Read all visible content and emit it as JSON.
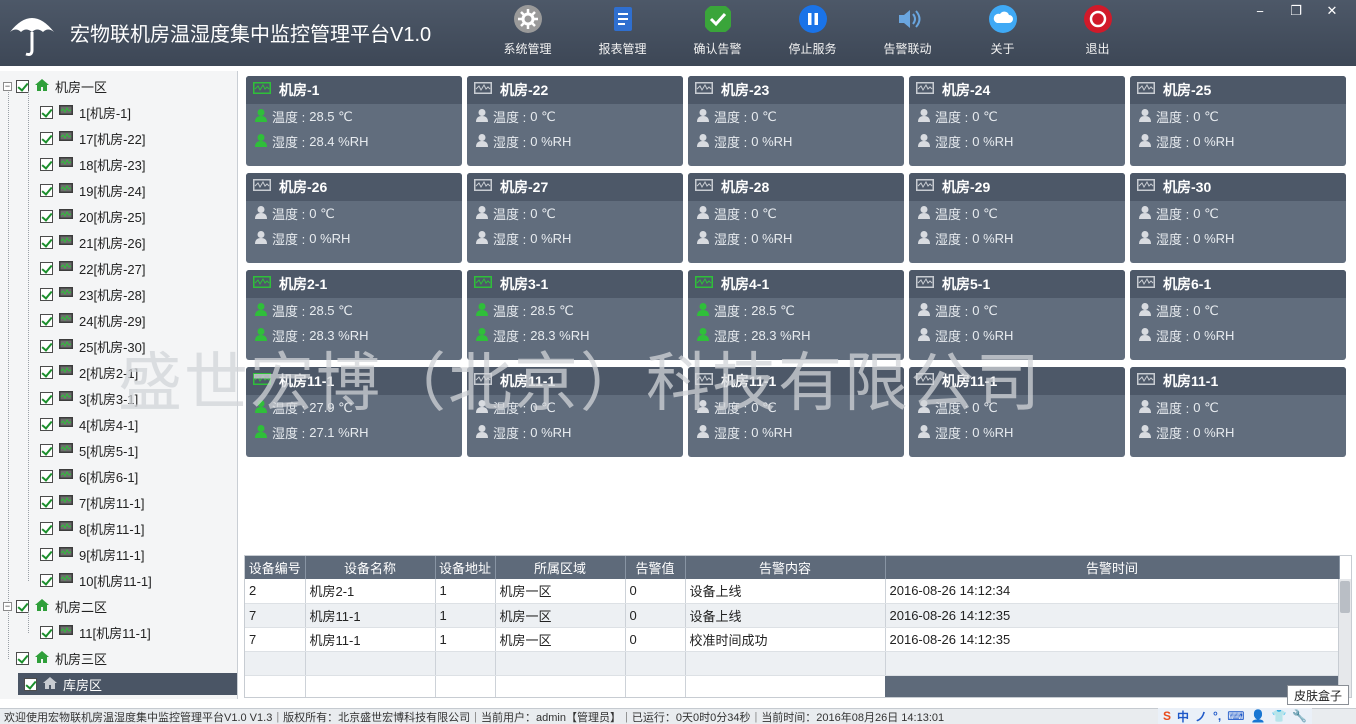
{
  "app": {
    "title": "宏物联机房温湿度集中监控管理平台V1.0"
  },
  "toolbar": [
    {
      "label": "系统管理",
      "icon": "gear-icon",
      "color": "#888888"
    },
    {
      "label": "报表管理",
      "icon": "document-icon",
      "color": "#2f6fd0"
    },
    {
      "label": "确认告警",
      "icon": "check-icon",
      "color": "#3aa53a"
    },
    {
      "label": "停止服务",
      "icon": "pause-icon",
      "color": "#1a73e8"
    },
    {
      "label": "告警联动",
      "icon": "speaker-icon",
      "color": "#6aa6e0"
    },
    {
      "label": "关于",
      "icon": "cloud-icon",
      "color": "#3fa9f5"
    },
    {
      "label": "退出",
      "icon": "power-icon",
      "color": "#d11a2a"
    }
  ],
  "window_controls": {
    "minimize": "−",
    "restore": "❐",
    "close": "✕"
  },
  "tree": {
    "areas": [
      {
        "label": "机房一区",
        "children": [
          "1[机房-1]",
          "17[机房-22]",
          "18[机房-23]",
          "19[机房-24]",
          "20[机房-25]",
          "21[机房-26]",
          "22[机房-27]",
          "23[机房-28]",
          "24[机房-29]",
          "25[机房-30]",
          "2[机房2-1]",
          "3[机房3-1]",
          "4[机房4-1]",
          "5[机房5-1]",
          "6[机房6-1]",
          "7[机房11-1]",
          "8[机房11-1]",
          "9[机房11-1]",
          "10[机房11-1]"
        ]
      },
      {
        "label": "机房二区",
        "children": [
          "11[机房11-1]"
        ]
      },
      {
        "label": "机房三区",
        "children": []
      },
      {
        "label": "库房区",
        "children": []
      }
    ]
  },
  "rooms": [
    {
      "name": "机房-1",
      "temp_label": "温度 :",
      "temp": "28.5 ℃",
      "hum_label": "湿度 :",
      "hum": "28.4 %RH",
      "online": true
    },
    {
      "name": "机房-22",
      "temp_label": "温度 :",
      "temp": "0 ℃",
      "hum_label": "湿度 :",
      "hum": "0 %RH",
      "online": false
    },
    {
      "name": "机房-23",
      "temp_label": "温度 :",
      "temp": "0 ℃",
      "hum_label": "湿度 :",
      "hum": "0 %RH",
      "online": false
    },
    {
      "name": "机房-24",
      "temp_label": "温度 :",
      "temp": "0 ℃",
      "hum_label": "湿度 :",
      "hum": "0 %RH",
      "online": false
    },
    {
      "name": "机房-25",
      "temp_label": "温度 :",
      "temp": "0 ℃",
      "hum_label": "湿度 :",
      "hum": "0 %RH",
      "online": false
    },
    {
      "name": "机房-26",
      "temp_label": "温度 :",
      "temp": "0 ℃",
      "hum_label": "湿度 :",
      "hum": "0 %RH",
      "online": false
    },
    {
      "name": "机房-27",
      "temp_label": "温度 :",
      "temp": "0 ℃",
      "hum_label": "湿度 :",
      "hum": "0 %RH",
      "online": false
    },
    {
      "name": "机房-28",
      "temp_label": "温度 :",
      "temp": "0 ℃",
      "hum_label": "湿度 :",
      "hum": "0 %RH",
      "online": false
    },
    {
      "name": "机房-29",
      "temp_label": "温度 :",
      "temp": "0 ℃",
      "hum_label": "湿度 :",
      "hum": "0 %RH",
      "online": false
    },
    {
      "name": "机房-30",
      "temp_label": "温度 :",
      "temp": "0 ℃",
      "hum_label": "湿度 :",
      "hum": "0 %RH",
      "online": false
    },
    {
      "name": "机房2-1",
      "temp_label": "温度 :",
      "temp": "28.5 ℃",
      "hum_label": "湿度 :",
      "hum": "28.3 %RH",
      "online": true
    },
    {
      "name": "机房3-1",
      "temp_label": "温度 :",
      "temp": "28.5 ℃",
      "hum_label": "湿度 :",
      "hum": "28.3 %RH",
      "online": true
    },
    {
      "name": "机房4-1",
      "temp_label": "温度 :",
      "temp": "28.5 ℃",
      "hum_label": "湿度 :",
      "hum": "28.3 %RH",
      "online": true
    },
    {
      "name": "机房5-1",
      "temp_label": "温度 :",
      "temp": "0 ℃",
      "hum_label": "湿度 :",
      "hum": "0 %RH",
      "online": false
    },
    {
      "name": "机房6-1",
      "temp_label": "温度 :",
      "temp": "0 ℃",
      "hum_label": "湿度 :",
      "hum": "0 %RH",
      "online": false
    },
    {
      "name": "机房11-1",
      "temp_label": "温度 :",
      "temp": "27.9 ℃",
      "hum_label": "湿度 :",
      "hum": "27.1 %RH",
      "online": true
    },
    {
      "name": "机房11-1",
      "temp_label": "温度 :",
      "temp": "0 ℃",
      "hum_label": "湿度 :",
      "hum": "0 %RH",
      "online": false
    },
    {
      "name": "机房11-1",
      "temp_label": "温度 :",
      "temp": "0 ℃",
      "hum_label": "湿度 :",
      "hum": "0 %RH",
      "online": false
    },
    {
      "name": "机房11-1",
      "temp_label": "温度 :",
      "temp": "0 ℃",
      "hum_label": "湿度 :",
      "hum": "0 %RH",
      "online": false
    },
    {
      "name": "机房11-1",
      "temp_label": "温度 :",
      "temp": "0 ℃",
      "hum_label": "湿度 :",
      "hum": "0 %RH",
      "online": false
    }
  ],
  "watermark": "盛世宏博（北京）科技有限公司",
  "alarm_table": {
    "columns": [
      "设备编号",
      "设备名称",
      "设备地址",
      "所属区域",
      "告警值",
      "告警内容",
      "告警时间"
    ],
    "rows": [
      [
        "2",
        "机房2-1",
        "1",
        "机房一区",
        "0",
        "设备上线",
        "2016-08-26 14:12:34"
      ],
      [
        "7",
        "机房11-1",
        "1",
        "机房一区",
        "0",
        "设备上线",
        "2016-08-26 14:12:35"
      ],
      [
        "7",
        "机房11-1",
        "1",
        "机房一区",
        "0",
        "校准时间成功",
        "2016-08-26 14:12:35"
      ],
      [
        "",
        "",
        "",
        "",
        "",
        "",
        ""
      ],
      [
        "",
        "",
        "",
        "",
        "",
        "",
        ""
      ]
    ]
  },
  "statusbar": {
    "welcome": "欢迎使用宏物联机房温湿度集中监控管理平台V1.0 V1.3",
    "copyright": "版权所有：北京盛世宏博科技有限公司",
    "user": "当前用户：admin【管理员】",
    "uptime": "已运行：0天0时0分34秒",
    "time": "当前时间：2016年08月26日 14:13:01"
  },
  "skin_button": "皮肤盒子",
  "ime": [
    "S",
    "中",
    "ノ",
    "°,",
    "⌨",
    "👤",
    "👕",
    "🔧"
  ],
  "colors": {
    "header": "#4d5868",
    "card": "#616d7d",
    "card_head": "#4d5868",
    "online": "#2fbf3a",
    "offline": "#c8ccd2"
  }
}
